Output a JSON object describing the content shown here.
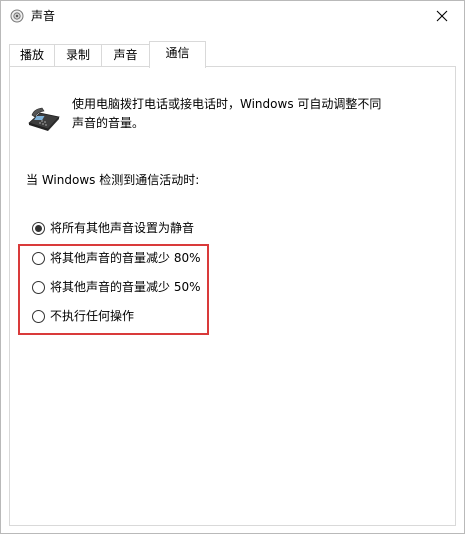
{
  "window": {
    "title": "声音",
    "accent_highlight": "#d93a3a"
  },
  "tabs": [
    {
      "label": "播放"
    },
    {
      "label": "录制"
    },
    {
      "label": "声音"
    },
    {
      "label": "通信"
    }
  ],
  "active_tab": "通信",
  "content": {
    "description_line1": "使用电脑拨打电话或接电话时，Windows 可自动调整不同",
    "description_line2": "声音的音量。",
    "section_label": "当 Windows 检测到通信活动时:",
    "options": [
      {
        "label": "将所有其他声音设置为静音",
        "checked": true
      },
      {
        "label": "将其他声音的音量减少 80%",
        "checked": false
      },
      {
        "label": "将其他声音的音量减少 50%",
        "checked": false
      },
      {
        "label": "不执行任何操作",
        "checked": false
      }
    ]
  },
  "icons": {
    "app": "speaker-icon",
    "close": "close-icon",
    "phone": "telephone-icon"
  }
}
